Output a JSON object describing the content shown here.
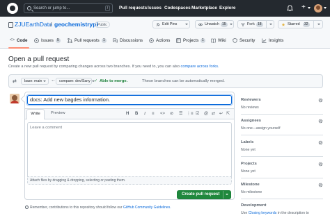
{
  "header": {
    "search_placeholder": "Search or jump to...",
    "slash_key": "/",
    "nav": [
      "Pull requests",
      "Issues",
      "Codespaces",
      "Marketplace",
      "Explore"
    ],
    "plus": "+"
  },
  "repo": {
    "owner": "ZJUEarthData",
    "slash": "/",
    "name": "geochemistrypi",
    "visibility": "Public",
    "edit_pins": "Edit Pins",
    "unwatch": "Unwatch",
    "watch_count": "15",
    "fork": "Fork",
    "fork_count": "18",
    "starred": "Starred",
    "star_count": "32"
  },
  "tabs": [
    {
      "label": "Code"
    },
    {
      "label": "Issues",
      "count": "5"
    },
    {
      "label": "Pull requests",
      "count": "1"
    },
    {
      "label": "Discussions"
    },
    {
      "label": "Actions"
    },
    {
      "label": "Projects",
      "count": "1"
    },
    {
      "label": "Wiki"
    },
    {
      "label": "Security"
    },
    {
      "label": "Insights"
    }
  ],
  "page": {
    "title": "Open a pull request",
    "subtitle": "Create a new pull request by comparing changes across two branches. If you need to, you can also",
    "subtitle_link": "compare across forks."
  },
  "compare": {
    "base": "base: main",
    "compare": "compare: dev/Sany",
    "arrow": "←",
    "check": "✓",
    "status": "Able to merge.",
    "description": "These branches can be automatically merged."
  },
  "form": {
    "title_value": "docs: Add new bagdes information.",
    "tab_write": "Write",
    "tab_preview": "Preview",
    "toolbar": [
      "H",
      "B",
      "I",
      "≡",
      "<>",
      "⊘",
      "☰",
      "⋮≡",
      "☑",
      "@",
      "⇄",
      "↩",
      "⇱"
    ],
    "comment_placeholder": "Leave a comment",
    "attach_text": "Attach files by dragging & dropping, selecting or pasting them.",
    "create_button": "Create pull request",
    "remember_text": "Remember, contributions to this repository should follow our",
    "remember_link": "GitHub Community Guidelines."
  },
  "sidebar": {
    "reviewers_label": "Reviewers",
    "reviewers_value": "No reviews",
    "assignees_label": "Assignees",
    "assignees_value": "No one—assign yourself",
    "labels_label": "Labels",
    "labels_value": "None yet",
    "projects_label": "Projects",
    "projects_value": "None yet",
    "milestone_label": "Milestone",
    "milestone_value": "No milestone",
    "development_label": "Development",
    "development_text": "Use",
    "development_link": "Closing keywords",
    "development_rest": "in the description to"
  },
  "colors": {
    "header_bg": "#24292f",
    "link": "#0969da",
    "success": "#1a7f37",
    "primary_button": "#1f883d",
    "tab_underline": "#fd8c73"
  }
}
